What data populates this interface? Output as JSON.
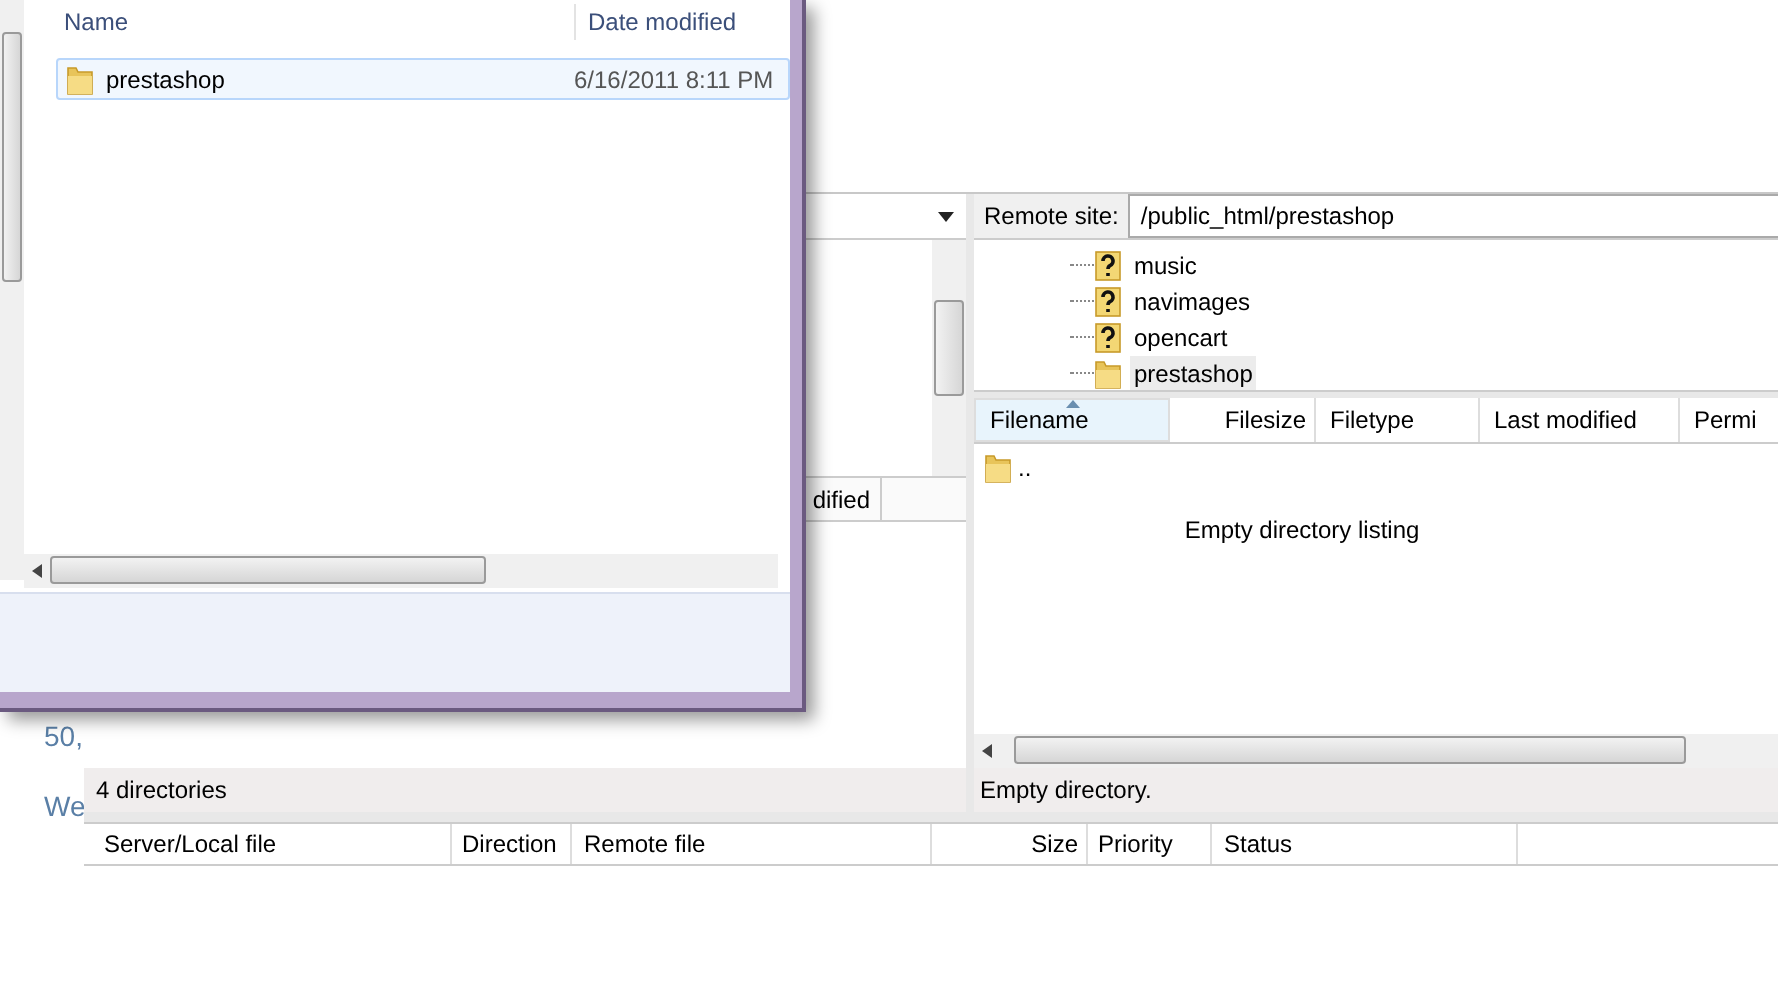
{
  "desktop": {
    "texts": [
      "50,",
      "We"
    ]
  },
  "local": {
    "list_header": [
      {
        "label": "dified"
      }
    ],
    "status": "4 directories"
  },
  "remote": {
    "label": "Remote site:",
    "path": "/public_html/prestashop",
    "tree": [
      {
        "name": "music",
        "kind": "unknown",
        "selected": false
      },
      {
        "name": "navimages",
        "kind": "unknown",
        "selected": false
      },
      {
        "name": "opencart",
        "kind": "unknown",
        "selected": false
      },
      {
        "name": "prestashop",
        "kind": "folder",
        "selected": true
      }
    ],
    "columns": [
      {
        "label": "Filename",
        "sorted": true
      },
      {
        "label": "Filesize",
        "sorted": false
      },
      {
        "label": "Filetype",
        "sorted": false
      },
      {
        "label": "Last modified",
        "sorted": false
      },
      {
        "label": "Permi",
        "sorted": false
      }
    ],
    "rows": [
      {
        "name": ".."
      }
    ],
    "empty_message": "Empty directory listing",
    "status": "Empty directory."
  },
  "queue": {
    "columns": [
      "Server/Local file",
      "Direction",
      "Remote file",
      "Size",
      "Priority",
      "Status"
    ]
  },
  "explorer": {
    "columns": [
      "Name",
      "Date modified"
    ],
    "rows": [
      {
        "name": "prestashop",
        "date": "6/16/2011 8:11 PM",
        "selected": true
      }
    ]
  }
}
